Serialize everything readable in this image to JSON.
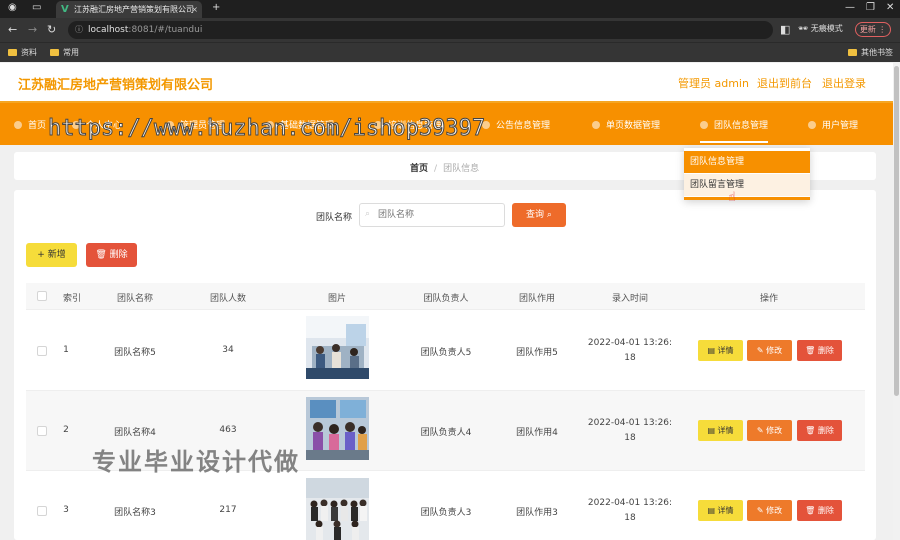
{
  "browser": {
    "tab_title": "江苏融汇房地产营销策划有限公司",
    "tab_close": "×",
    "new_tab": "+",
    "url_host": "localhost",
    "url_path": ":8081/#/tuandui",
    "incognito_label": "无痕模式",
    "update_label": "更新",
    "bookmarks": [
      "资料",
      "常用"
    ],
    "other_bookmarks": "其他书签"
  },
  "header": {
    "brand": "江苏融汇房地产营销策划有限公司",
    "admin_label": "管理员 admin",
    "back_to_front": "退出到前台",
    "logout": "退出登录"
  },
  "menu": {
    "items": [
      {
        "label": "首页"
      },
      {
        "label": "个人中心"
      },
      {
        "label": "管理员管理"
      },
      {
        "label": "基础数据管理"
      },
      {
        "label": "培训信息管理"
      },
      {
        "label": "公告信息管理"
      },
      {
        "label": "单页数据管理"
      },
      {
        "label": "团队信息管理"
      },
      {
        "label": "用户管理"
      }
    ],
    "dropdown": [
      "团队信息管理",
      "团队留言管理"
    ]
  },
  "watermarks": {
    "url": "https://www.huzhan.com/ishop39397",
    "text": "专业毕业设计代做"
  },
  "breadcrumb": {
    "home": "首页",
    "separator": "/",
    "current": "团队信息"
  },
  "search": {
    "label": "团队名称",
    "placeholder": "团队名称",
    "button": "查询"
  },
  "toolbar": {
    "add": "新增",
    "delete": "删除"
  },
  "table": {
    "headers": [
      "索引",
      "团队名称",
      "团队人数",
      "图片",
      "团队负责人",
      "团队作用",
      "录入时间",
      "操作"
    ],
    "rows": [
      {
        "index": "1",
        "name": "团队名称5",
        "count": "34",
        "leader": "团队负责人5",
        "role": "团队作用5",
        "time1": "2022-04-01 13:26:",
        "time2": "18"
      },
      {
        "index": "2",
        "name": "团队名称4",
        "count": "463",
        "leader": "团队负责人4",
        "role": "团队作用4",
        "time1": "2022-04-01 13:26:",
        "time2": "18"
      },
      {
        "index": "3",
        "name": "团队名称3",
        "count": "217",
        "leader": "团队负责人3",
        "role": "团队作用3",
        "time1": "2022-04-01 13:26:",
        "time2": "18"
      }
    ],
    "actions": {
      "detail": "详情",
      "edit": "修改",
      "remove": "删除"
    }
  },
  "colors": {
    "primary": "#f79000",
    "brand_text": "#f39800",
    "query_button": "#ee6b2a",
    "add_button": "#f6dc3a",
    "delete_button": "#e4533a"
  }
}
